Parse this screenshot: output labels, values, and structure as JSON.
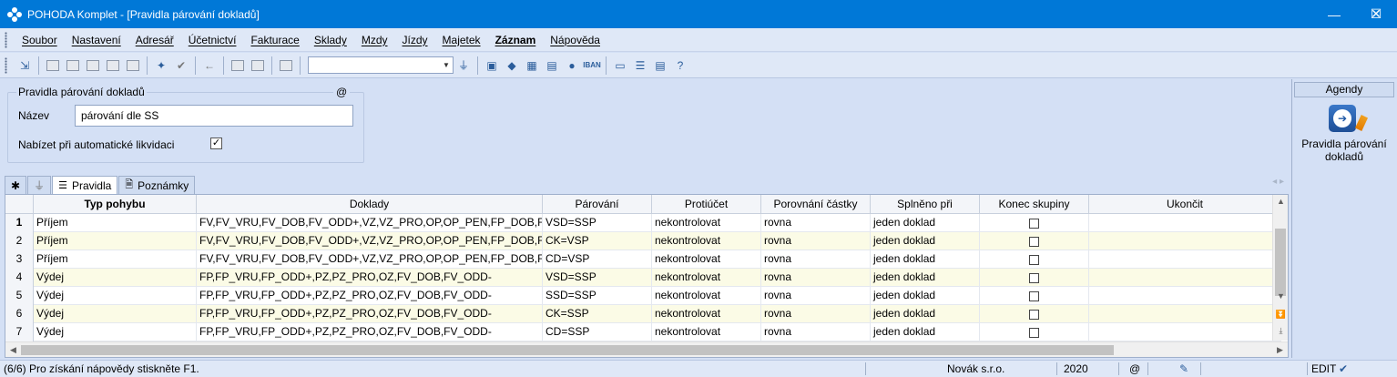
{
  "window": {
    "title": "POHODA Komplet - [Pravidla párování dokladů]",
    "minimize": "—",
    "maximize": "☐",
    "close": "✕"
  },
  "menu": [
    "Soubor",
    "Nastavení",
    "Adresář",
    "Účetnictví",
    "Fakturace",
    "Sklady",
    "Mzdy",
    "Jízdy",
    "Majetek",
    "Záznam",
    "Nápověda"
  ],
  "form": {
    "group_title": "Pravidla párování dokladů",
    "group_marker": "@",
    "name_label": "Název",
    "name_value": "párování dle SS",
    "auto_label": "Nabízet při automatické likvidaci",
    "auto_checked": "✓"
  },
  "agenda": {
    "header": "Agendy",
    "item_label": "Pravidla párování dokladů"
  },
  "tabs": {
    "star": "✱",
    "filter": "⏚",
    "items": [
      {
        "label": "Pravidla",
        "icon": "☰"
      },
      {
        "label": "Poznámky",
        "icon": "🗎"
      }
    ],
    "nav": "◂ ▸"
  },
  "grid": {
    "columns": [
      "Typ pohybu",
      "Doklady",
      "Párování",
      "Protiúčet",
      "Porovnání částky",
      "Splněno při",
      "Konec skupiny",
      "Ukončit"
    ],
    "rows": [
      {
        "n": "1",
        "typ": "Příjem",
        "doklady": "FV,FV_VRU,FV_DOB,FV_ODD+,VZ,VZ_PRO,OP,OP_PEN,FP_DOB,FP_OD",
        "parovani": "VSD=SSP",
        "protiucet": "nekontrolovat",
        "porovnani": "rovna",
        "splneno": "jeden doklad"
      },
      {
        "n": "2",
        "typ": "Příjem",
        "doklady": "FV,FV_VRU,FV_DOB,FV_ODD+,VZ,VZ_PRO,OP,OP_PEN,FP_DOB,FP_OD",
        "parovani": "CK=VSP",
        "protiucet": "nekontrolovat",
        "porovnani": "rovna",
        "splneno": "jeden doklad"
      },
      {
        "n": "3",
        "typ": "Příjem",
        "doklady": "FV,FV_VRU,FV_DOB,FV_ODD+,VZ,VZ_PRO,OP,OP_PEN,FP_DOB,FP_OD",
        "parovani": "CD=VSP",
        "protiucet": "nekontrolovat",
        "porovnani": "rovna",
        "splneno": "jeden doklad"
      },
      {
        "n": "4",
        "typ": "Výdej",
        "doklady": "FP,FP_VRU,FP_ODD+,PZ,PZ_PRO,OZ,FV_DOB,FV_ODD-",
        "parovani": "VSD=SSP",
        "protiucet": "nekontrolovat",
        "porovnani": "rovna",
        "splneno": "jeden doklad"
      },
      {
        "n": "5",
        "typ": "Výdej",
        "doklady": "FP,FP_VRU,FP_ODD+,PZ,PZ_PRO,OZ,FV_DOB,FV_ODD-",
        "parovani": "SSD=SSP",
        "protiucet": "nekontrolovat",
        "porovnani": "rovna",
        "splneno": "jeden doklad"
      },
      {
        "n": "6",
        "typ": "Výdej",
        "doklady": "FP,FP_VRU,FP_ODD+,PZ,PZ_PRO,OZ,FV_DOB,FV_ODD-",
        "parovani": "CK=SSP",
        "protiucet": "nekontrolovat",
        "porovnani": "rovna",
        "splneno": "jeden doklad"
      },
      {
        "n": "7",
        "typ": "Výdej",
        "doklady": "FP,FP_VRU,FP_ODD+,PZ,PZ_PRO,OZ,FV_DOB,FV_ODD-",
        "parovani": "CD=SSP",
        "protiucet": "nekontrolovat",
        "porovnani": "rovna",
        "splneno": "jeden doklad"
      }
    ]
  },
  "status": {
    "help": "(6/6) Pro získání nápovědy stiskněte F1.",
    "company": "Novák s.r.o.",
    "year": "2020",
    "at": "@",
    "mode": "EDIT"
  },
  "colors": {
    "titlebar": "#0078d7",
    "background": "#d4e0f5",
    "row_alt": "#fbfbe6"
  }
}
